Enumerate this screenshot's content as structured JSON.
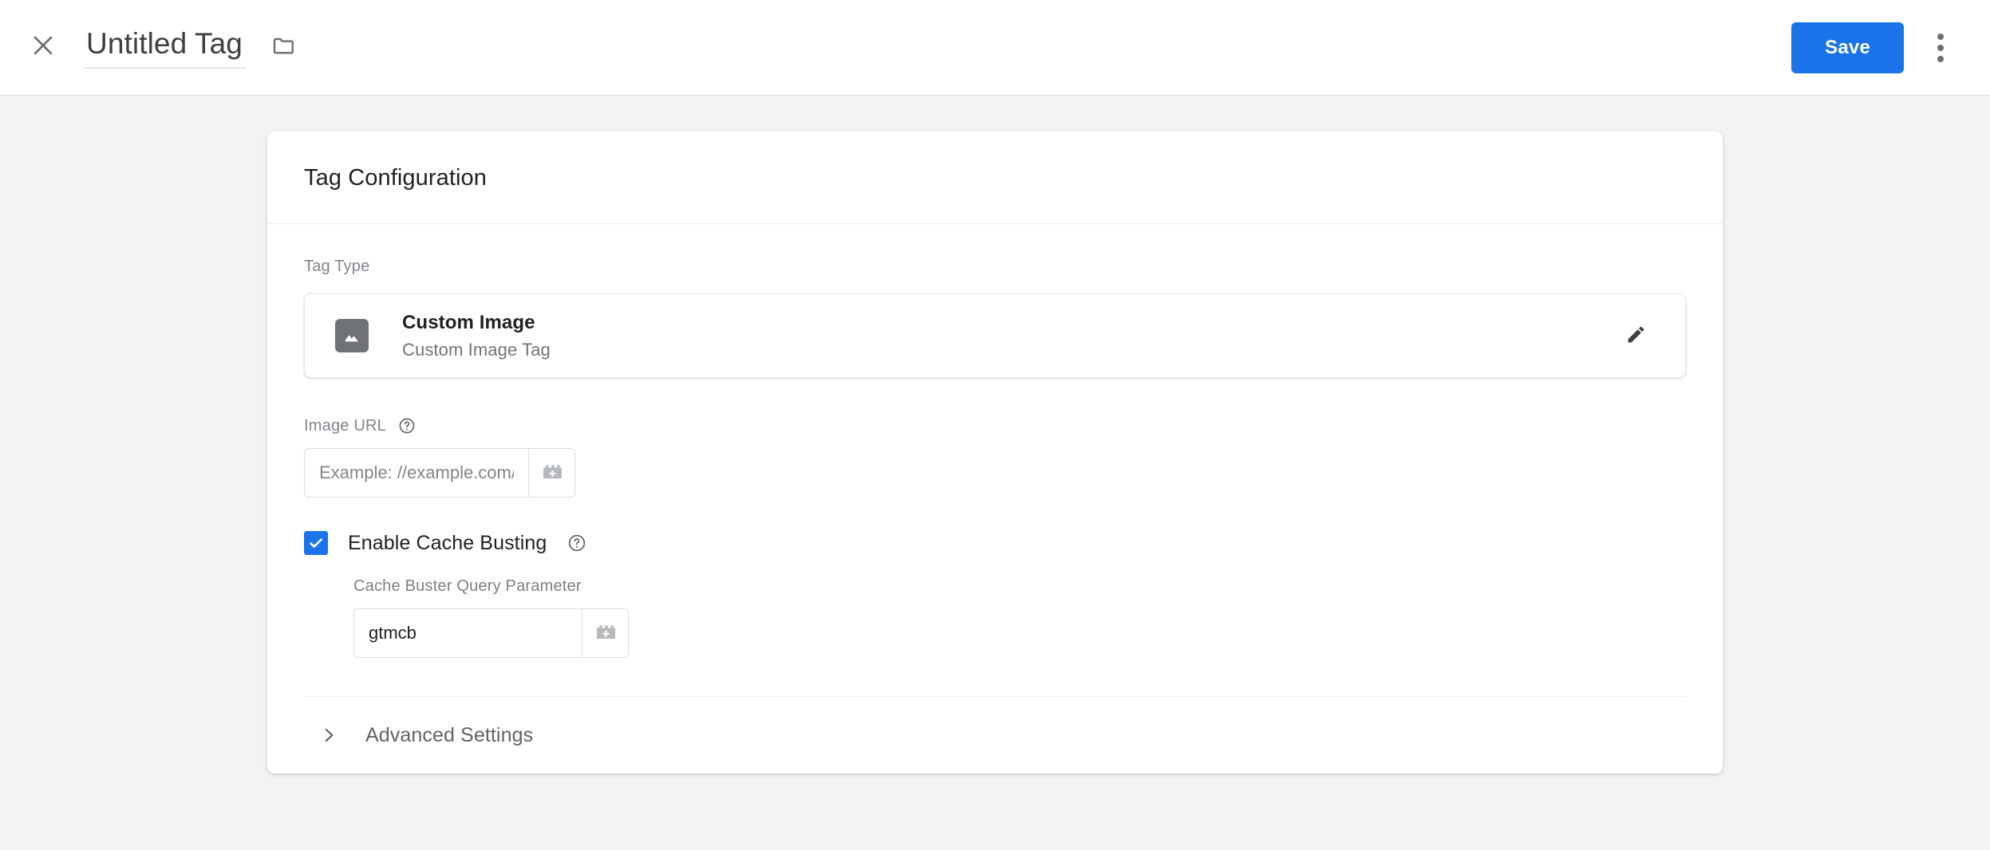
{
  "header": {
    "close_icon": "close-icon",
    "tag_name": "Untitled Tag",
    "folder_icon": "folder-icon",
    "save_label": "Save",
    "more_icon": "more-vert-icon",
    "accent_color": "#1a73e8"
  },
  "card": {
    "title": "Tag Configuration",
    "tag_type": {
      "label": "Tag Type",
      "icon": "image-icon",
      "name": "Custom Image",
      "description": "Custom Image Tag",
      "edit_icon": "pencil-icon"
    },
    "image_url": {
      "label": "Image URL",
      "help_icon": "help-circle-icon",
      "value": "",
      "placeholder": "Example: //example.com/a.gif",
      "variable_icon": "insert-variable-icon"
    },
    "cache_busting": {
      "label": "Enable Cache Busting",
      "checked": true,
      "help_icon": "help-circle-icon",
      "checkbox_color": "#1a73e8",
      "param_label": "Cache Buster Query Parameter",
      "param_value": "gtmcb",
      "param_placeholder": "",
      "variable_icon": "insert-variable-icon"
    },
    "advanced": {
      "chevron_icon": "chevron-right-icon",
      "label": "Advanced Settings"
    }
  }
}
